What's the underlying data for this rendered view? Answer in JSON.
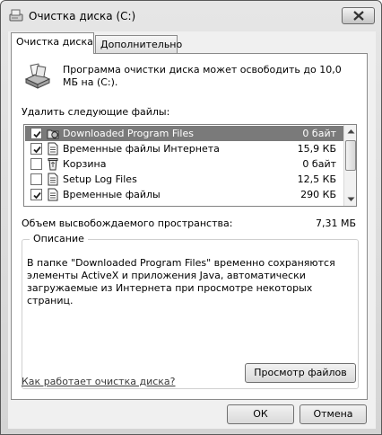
{
  "window": {
    "title": "Очистка диска  (C:)"
  },
  "tabs": [
    {
      "label": "Очистка диска",
      "active": true
    },
    {
      "label": "Дополнительно",
      "active": false
    }
  ],
  "intro_text": "Программа очистки диска может освободить до 10,0 МБ на (C:).",
  "files_label": "Удалить следующие файлы:",
  "files": [
    {
      "name": "Downloaded Program Files",
      "size": "0 байт",
      "checked": true,
      "selected": true,
      "icon": "folder-globe-icon"
    },
    {
      "name": "Временные файлы Интернета",
      "size": "15,9 КБ",
      "checked": true,
      "selected": false,
      "icon": "document-icon"
    },
    {
      "name": "Корзина",
      "size": "0 байт",
      "checked": false,
      "selected": false,
      "icon": "recycle-bin-icon"
    },
    {
      "name": "Setup Log Files",
      "size": "12,5 КБ",
      "checked": false,
      "selected": false,
      "icon": "document-icon"
    },
    {
      "name": "Временные файлы",
      "size": "290 КБ",
      "checked": true,
      "selected": false,
      "icon": "document-icon"
    }
  ],
  "total": {
    "label": "Объем высвобождаемого пространства:",
    "value": "7,31 МБ"
  },
  "description": {
    "legend": "Описание",
    "text": "В папке \"Downloaded Program Files\" временно сохраняются элементы ActiveX и приложения Java, автоматически загружаемые из Интернета при просмотре некоторых страниц."
  },
  "buttons": {
    "view_files": "Просмотр файлов",
    "ok": "ОК",
    "cancel": "Отмена"
  },
  "help_link": "Как работает очистка диска?"
}
